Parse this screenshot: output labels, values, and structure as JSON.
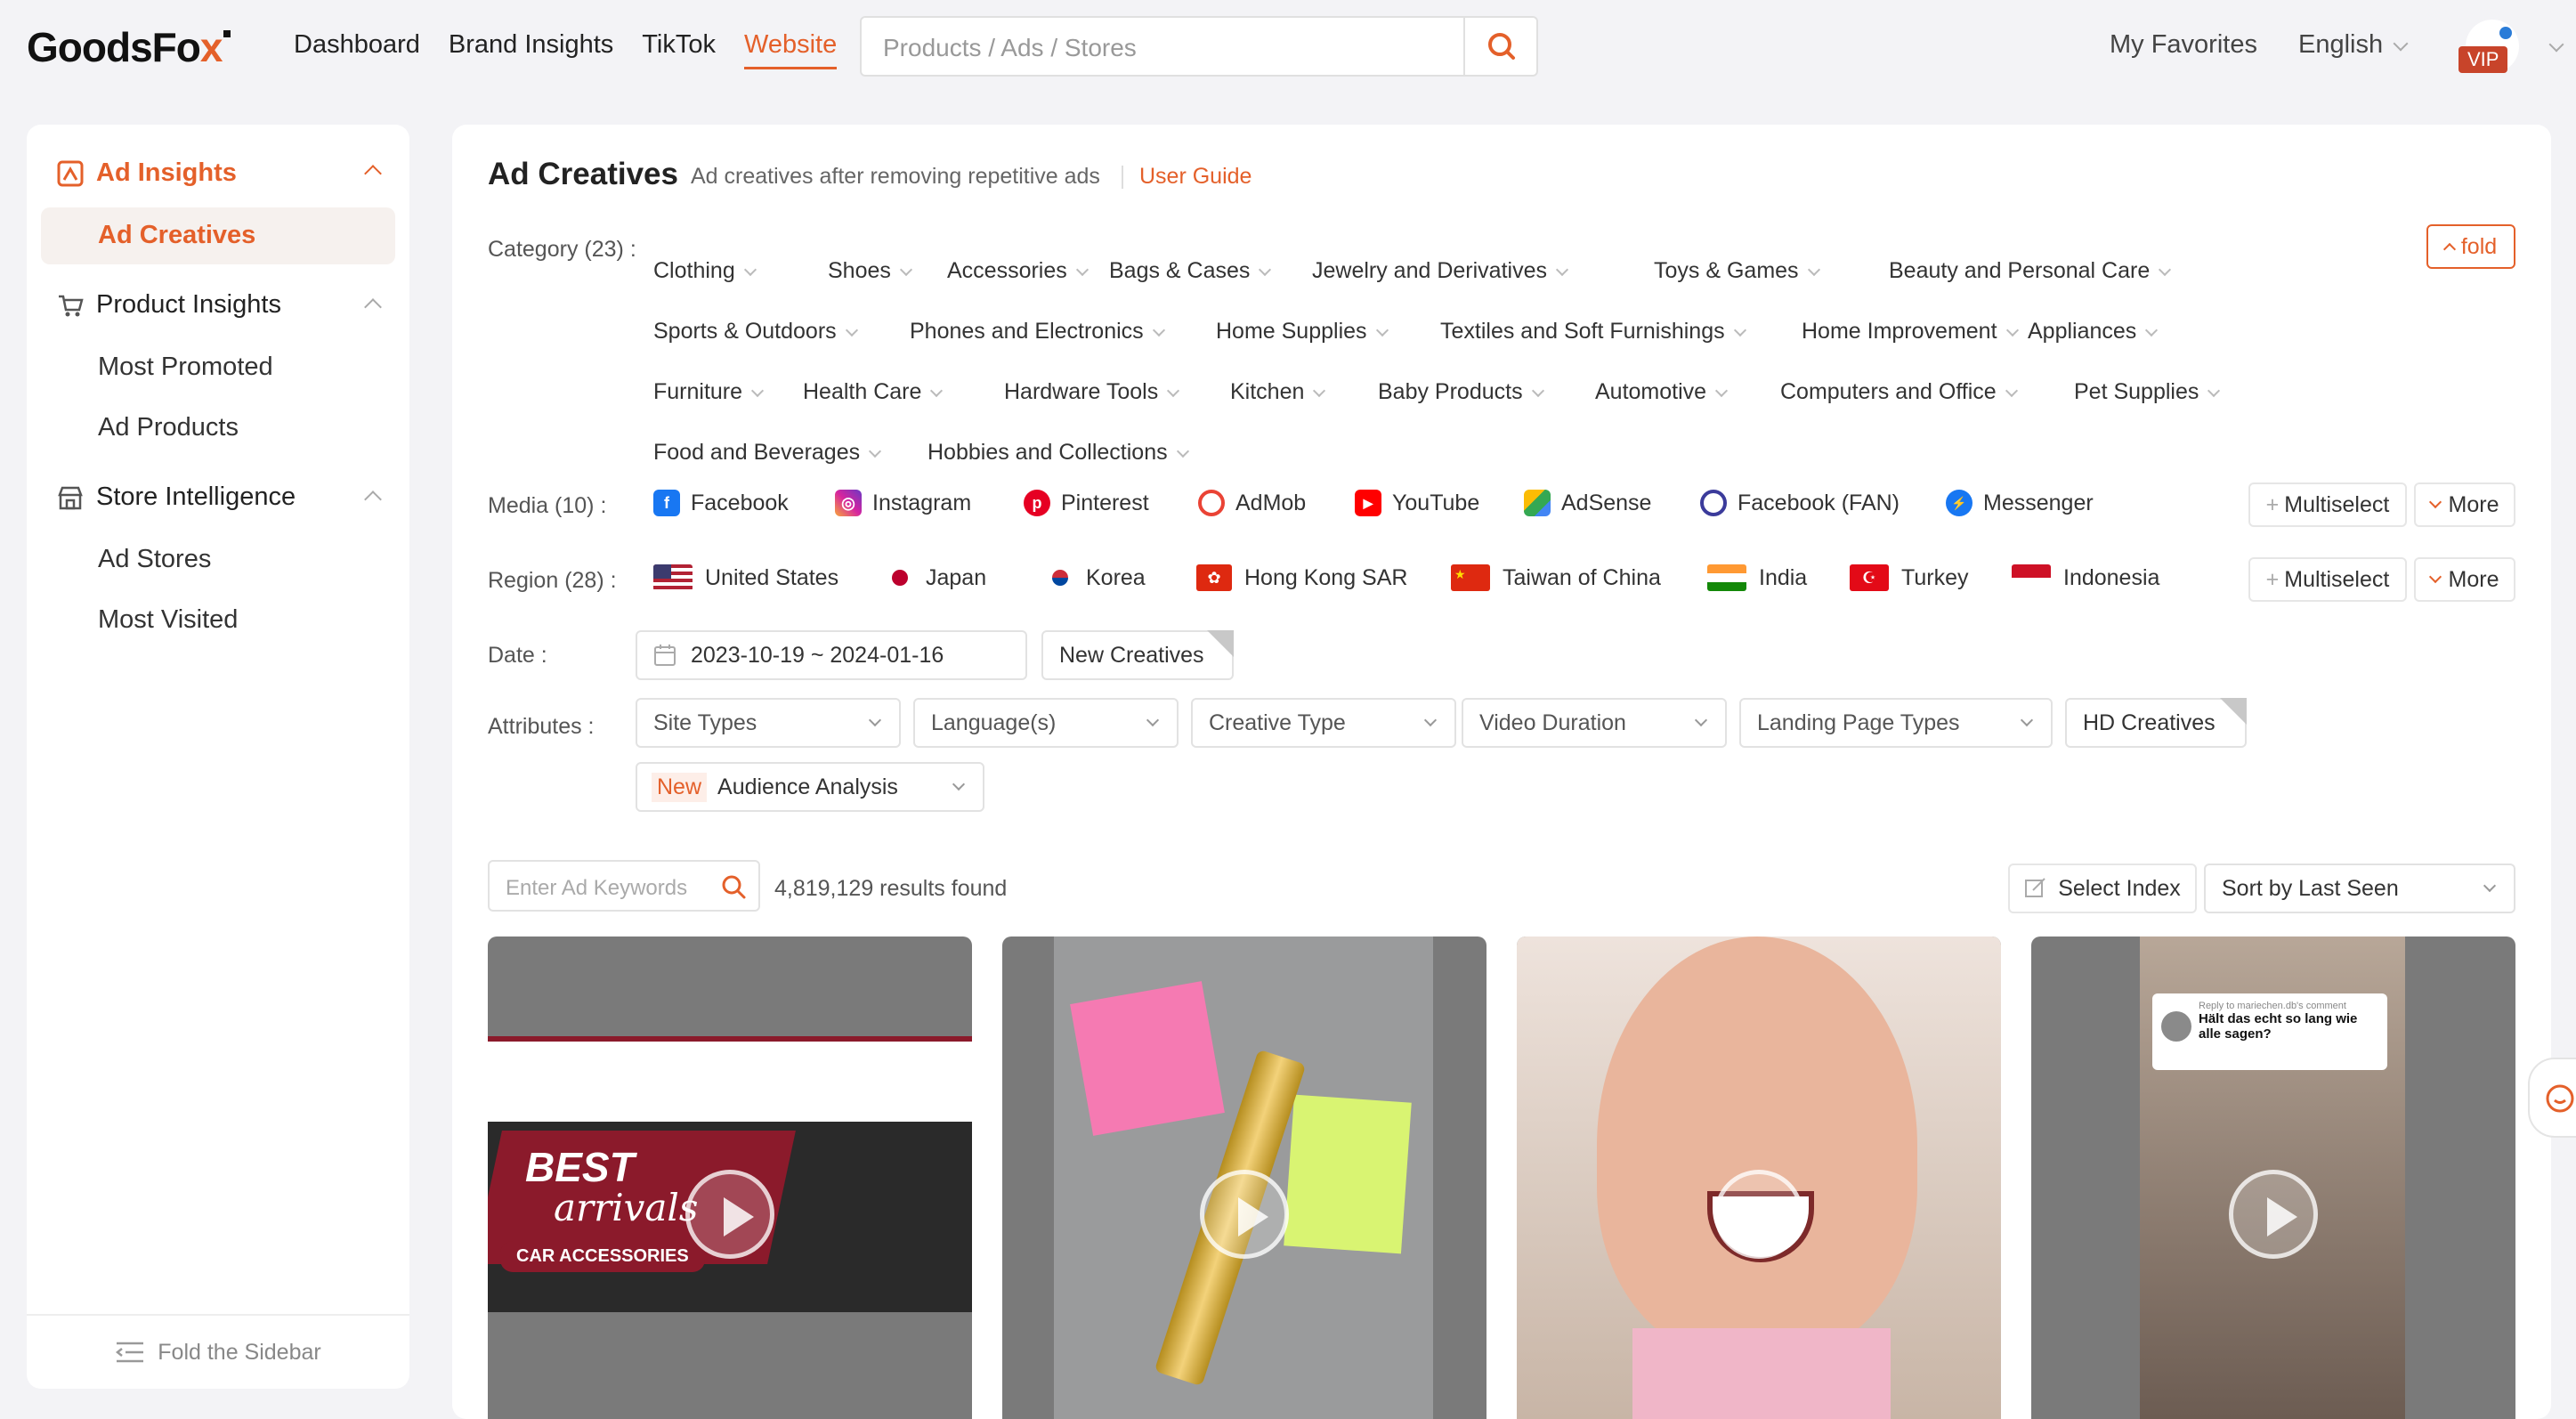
{
  "header": {
    "logo_main": "GoodsFo",
    "logo_x": "x",
    "nav": [
      "Dashboard",
      "Brand Insights",
      "TikTok",
      "Website"
    ],
    "nav_active": "Website",
    "search_placeholder": "Products / Ads / Stores",
    "favorites": "My Favorites",
    "language": "English",
    "vip": "VIP"
  },
  "sidebar": {
    "groups": [
      {
        "label": "Ad Insights",
        "icon": "ad-insights-icon",
        "items": [
          "Ad Creatives"
        ]
      },
      {
        "label": "Product Insights",
        "icon": "cart-icon",
        "items": [
          "Most Promoted",
          "Ad Products"
        ]
      },
      {
        "label": "Store Intelligence",
        "icon": "store-icon",
        "items": [
          "Ad Stores",
          "Most Visited"
        ]
      }
    ],
    "fold": "Fold the Sidebar"
  },
  "main": {
    "title": "Ad Creatives",
    "subtitle": "Ad creatives after removing repetitive ads",
    "guide": "User Guide",
    "category_label": "Category",
    "category_count": "(23)",
    "categories": [
      "Clothing",
      "Shoes",
      "Accessories",
      "Bags & Cases",
      "Jewelry and Derivatives",
      "Toys & Games",
      "Beauty and Personal Care",
      "Sports & Outdoors",
      "Phones and Electronics",
      "Home Supplies",
      "Textiles and Soft Furnishings",
      "Home Improvement",
      "Appliances",
      "Furniture",
      "Health Care",
      "Hardware Tools",
      "Kitchen",
      "Baby Products",
      "Automotive",
      "Computers and Office",
      "Pet Supplies",
      "Food and Beverages",
      "Hobbies and Collections"
    ],
    "fold_btn": "fold",
    "media_label": "Media",
    "media_count": "(10)",
    "media": [
      "Facebook",
      "Instagram",
      "Pinterest",
      "AdMob",
      "YouTube",
      "AdSense",
      "Facebook (FAN)",
      "Messenger"
    ],
    "region_label": "Region",
    "region_count": "(28)",
    "regions": [
      "United States",
      "Japan",
      "Korea",
      "Hong Kong SAR",
      "Taiwan of China",
      "India",
      "Turkey",
      "Indonesia"
    ],
    "multiselect": "Multiselect",
    "more": "More",
    "date_label": "Date",
    "date_range": "2023-10-19 ~ 2024-01-16",
    "new_creatives": "New Creatives",
    "attributes_label": "Attributes",
    "attributes": [
      "Site Types",
      "Language(s)",
      "Creative Type",
      "Video Duration",
      "Landing Page Types"
    ],
    "hd": "HD Creatives",
    "new_tag": "New",
    "audience": "Audience Analysis",
    "keyword_placeholder": "Enter Ad Keywords",
    "results": "4,819,129 results found",
    "select_index": "Select Index",
    "sort": "Sort by Last Seen",
    "card1_best": "BEST",
    "card1_arrivals": "arrivals",
    "card1_car": "CAR ACCESSORIES",
    "card4_reply": "Reply to mariechen.db's comment",
    "card4_text": "Hält das echt so lang wie alle sagen?"
  },
  "colors": {
    "accent": "#e4602a",
    "vip": "#c8442a"
  }
}
